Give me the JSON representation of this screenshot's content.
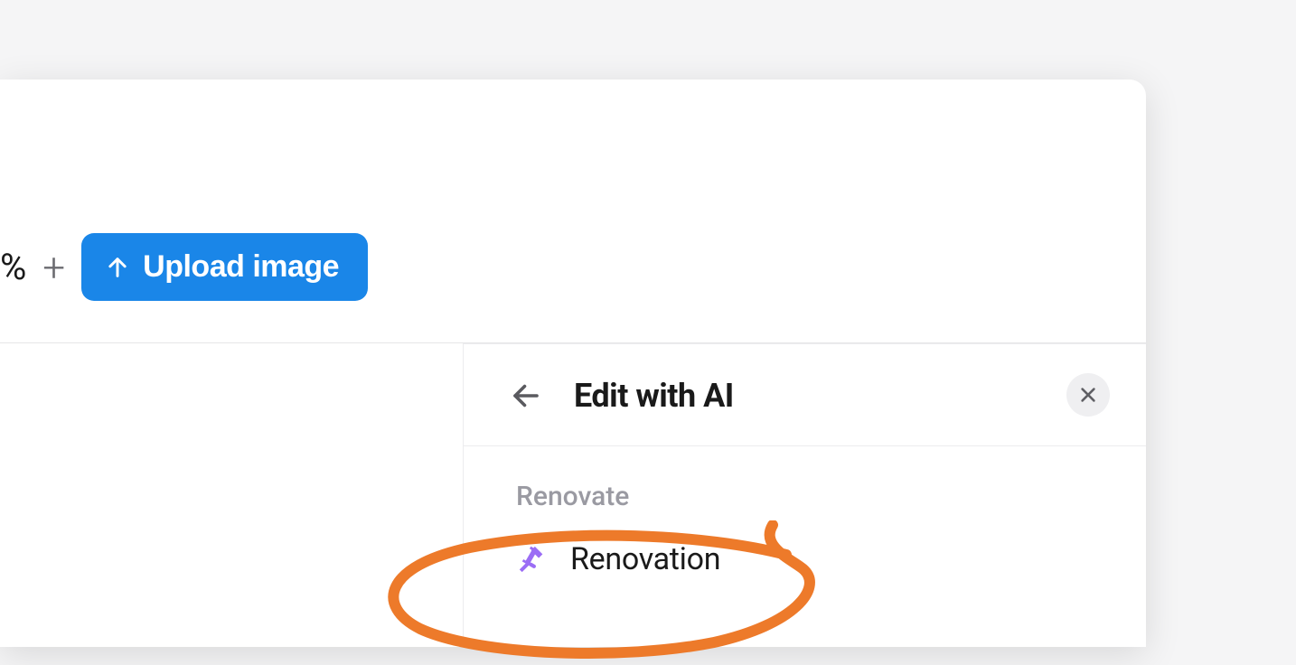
{
  "toolbar": {
    "percent_symbol": "%",
    "plus_symbol": "+",
    "upload_label": "Upload image"
  },
  "panel": {
    "title": "Edit with AI",
    "section_label": "Renovate",
    "items": [
      {
        "icon": "hammer-icon",
        "label": "Renovation"
      }
    ]
  }
}
